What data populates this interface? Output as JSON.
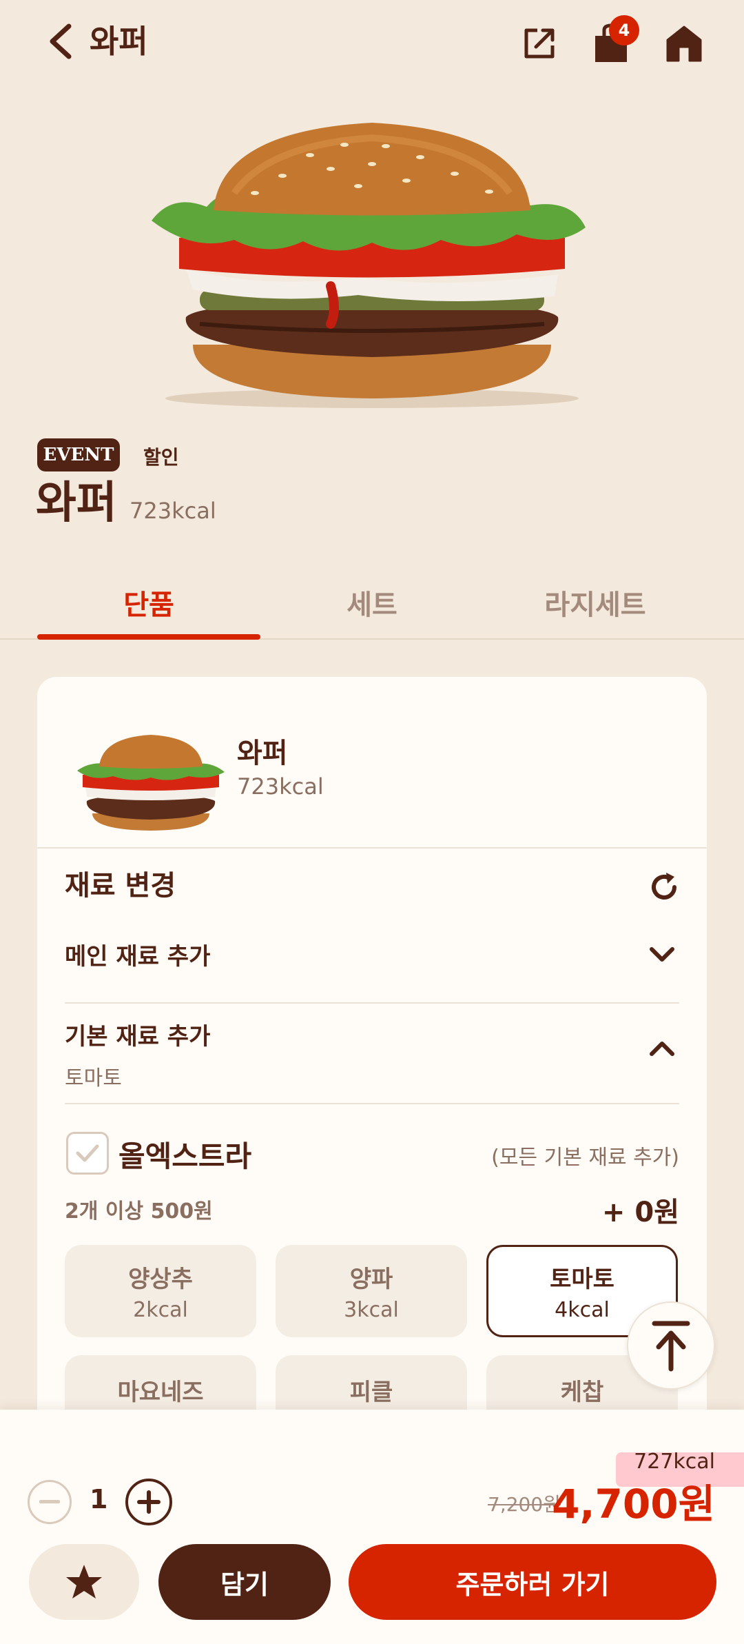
{
  "header": {
    "title": "와퍼",
    "cart_count": "4"
  },
  "product": {
    "event_badge": "EVENT",
    "event_tag": "할인",
    "name": "와퍼",
    "kcal": "723kcal"
  },
  "tabs": [
    {
      "label": "단품",
      "active": true
    },
    {
      "label": "세트",
      "active": false
    },
    {
      "label": "라지세트",
      "active": false
    }
  ],
  "card": {
    "item_name": "와퍼",
    "item_kcal": "723kcal",
    "section_title": "재료 변경",
    "main_add": {
      "title": "메인 재료 추가"
    },
    "basic_add": {
      "title": "기본 재료 추가",
      "selected": "토마토"
    },
    "all_extra": {
      "label": "올엑스트라",
      "note": "(모든 기본 재료 추가)",
      "price_note": "2개 이상 500원",
      "price": "+ 0원"
    },
    "options": [
      {
        "name": "양상추",
        "kcal": "2kcal",
        "selected": false
      },
      {
        "name": "양파",
        "kcal": "3kcal",
        "selected": false
      },
      {
        "name": "토마토",
        "kcal": "4kcal",
        "selected": true
      },
      {
        "name": "마요네즈",
        "kcal": "",
        "selected": false
      },
      {
        "name": "피클",
        "kcal": "",
        "selected": false
      },
      {
        "name": "케찹",
        "kcal": "",
        "selected": false
      }
    ]
  },
  "bottom": {
    "total_kcal": "727kcal",
    "quantity": "1",
    "original_price": "7,200원",
    "sale_price": "4,700원",
    "cart_label": "담기",
    "order_label": "주문하러 가기"
  },
  "colors": {
    "brand_red": "#d62300",
    "brand_brown": "#502314",
    "background": "#f3e9dc"
  }
}
